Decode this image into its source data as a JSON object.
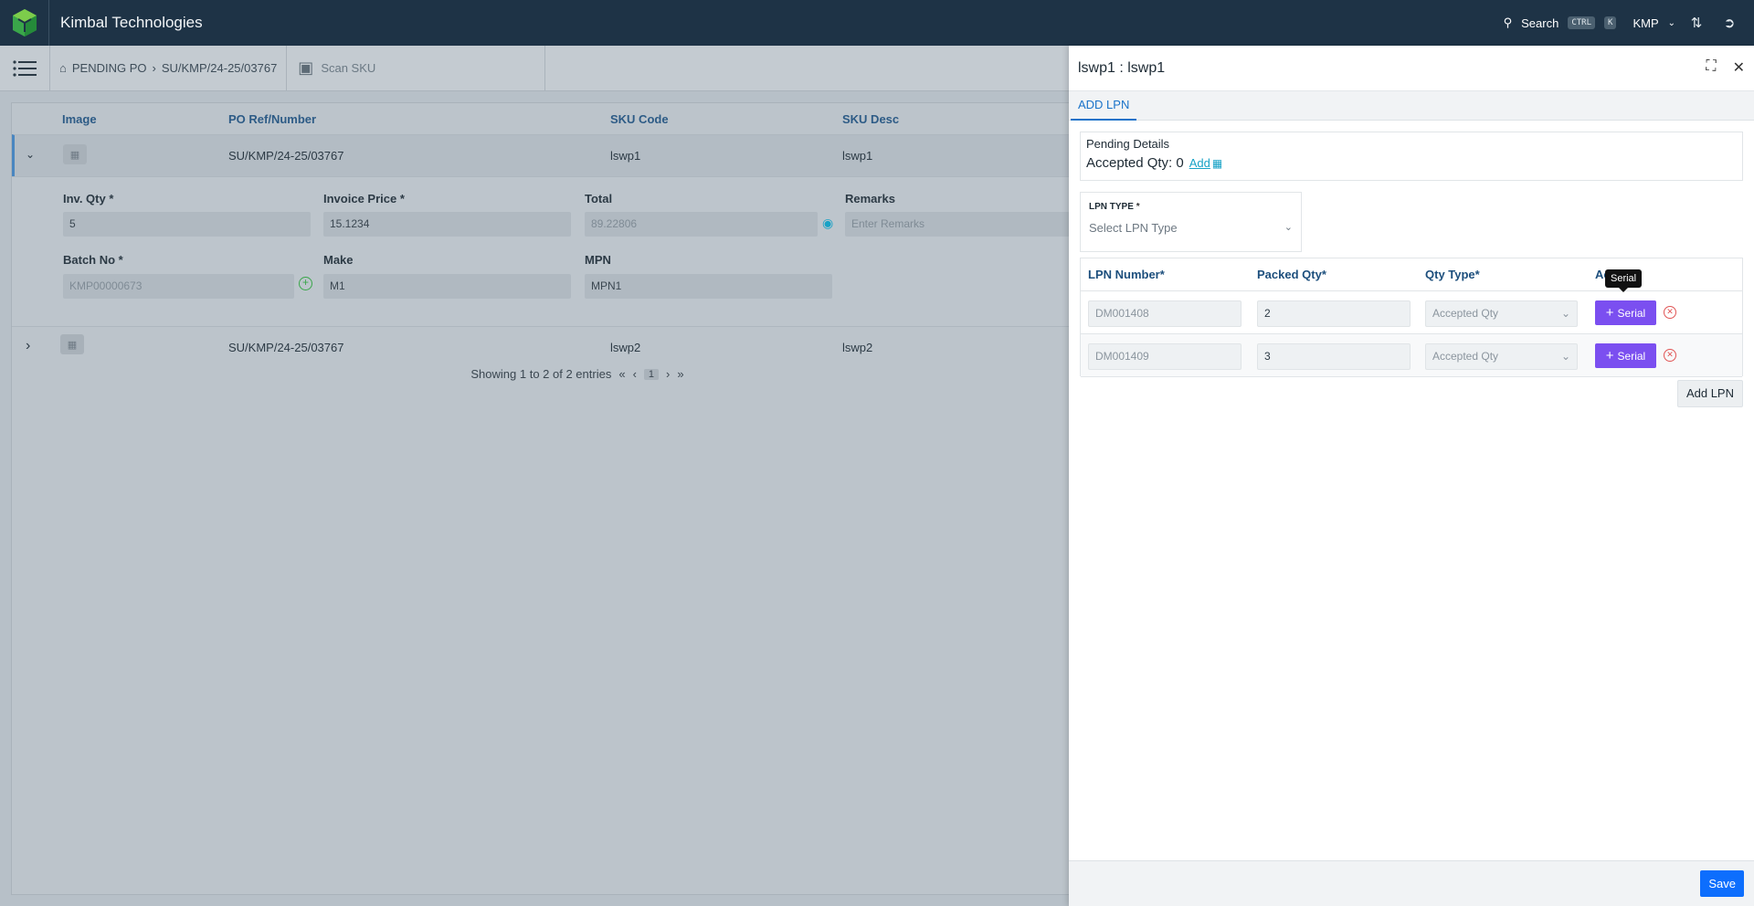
{
  "app": {
    "brand": "Kimbal Technologies"
  },
  "topbar": {
    "search_label": "Search",
    "kbd_ctrl": "CTRL",
    "kbd_k": "K",
    "org": "KMP"
  },
  "breadcrumb": {
    "home": "PENDING PO",
    "current": "SU/KMP/24-25/03767"
  },
  "scan": {
    "label": "Scan SKU"
  },
  "table": {
    "headers": [
      "Image",
      "PO Ref/Number",
      "SKU Code",
      "SKU Desc"
    ],
    "rows": [
      {
        "po": "SU/KMP/24-25/03767",
        "sku": "lswp1",
        "desc": "lswp1"
      },
      {
        "po": "SU/KMP/24-25/03767",
        "sku": "lswp2",
        "desc": "lswp2"
      }
    ],
    "detail": {
      "inv_qty_label": "Inv. Qty *",
      "inv_qty": "5",
      "price_label": "Invoice Price *",
      "price": "15.1234",
      "total_label": "Total",
      "total": "89.22806",
      "remarks_label": "Remarks",
      "remarks_ph": "Enter Remarks",
      "batch_label": "Batch No *",
      "batch": "KMP00000673",
      "make_label": "Make",
      "make": "M1",
      "mpn_label": "MPN",
      "mpn": "MPN1"
    },
    "pager": {
      "text": "Showing 1 to 2 of 2 entries",
      "page": "1"
    }
  },
  "panel": {
    "title": "lswp1 : lswp1",
    "tab": "ADD LPN",
    "pending_title": "Pending Details",
    "accepted": "Accepted Qty: 0",
    "add_link": "Add",
    "lpn_type_label": "LPN TYPE",
    "lpn_type_ph": "Select LPN Type",
    "cols": [
      "LPN Number*",
      "Packed Qty*",
      "Qty Type*",
      "Action"
    ],
    "lpns": [
      {
        "number": "DM001408",
        "qty": "2",
        "type": "Accepted Qty"
      },
      {
        "number": "DM001409",
        "qty": "3",
        "type": "Accepted Qty"
      }
    ],
    "serial_label": "Serial",
    "tooltip": "Serial",
    "add_lpn": "Add LPN",
    "save": "Save"
  }
}
